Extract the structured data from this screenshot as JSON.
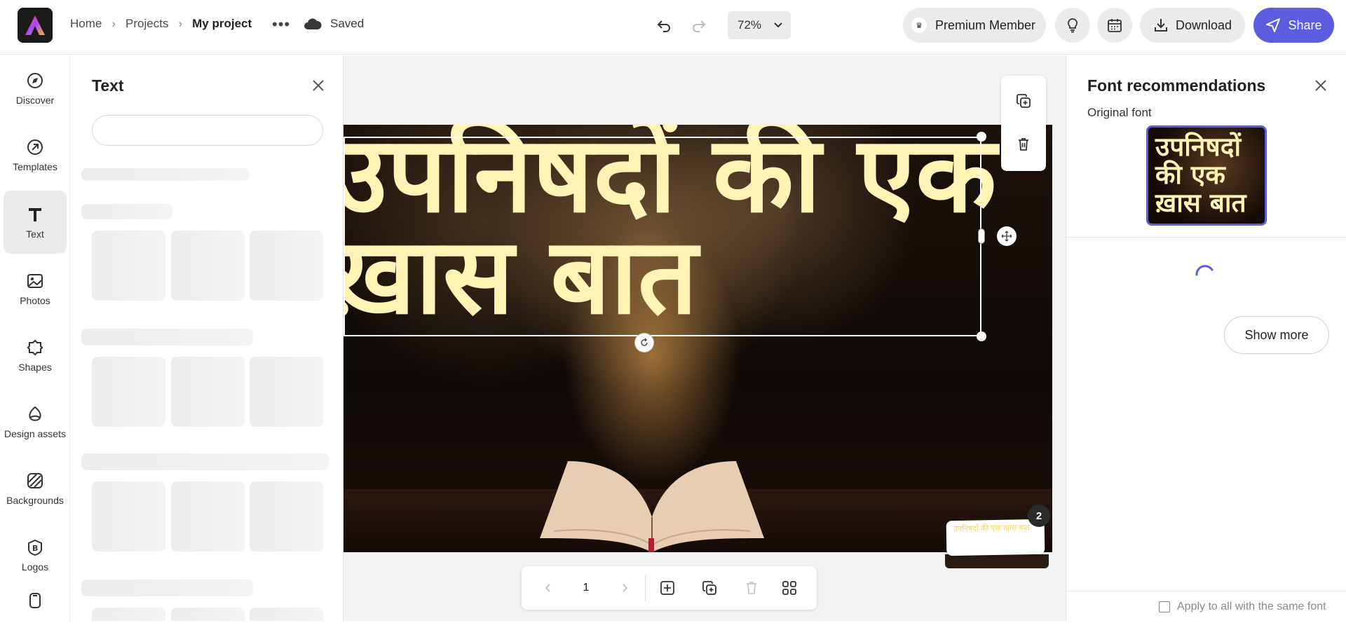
{
  "header": {
    "breadcrumb": [
      "Home",
      "Projects",
      "My project"
    ],
    "save_status": "Saved",
    "zoom": "72%",
    "premium_label": "Premium Member",
    "download_label": "Download",
    "share_label": "Share"
  },
  "rail": {
    "items": [
      {
        "label": "Discover"
      },
      {
        "label": "Templates"
      },
      {
        "label": "Text"
      },
      {
        "label": "Photos"
      },
      {
        "label": "Shapes"
      },
      {
        "label": "Design assets"
      },
      {
        "label": "Backgrounds"
      },
      {
        "label": "Logos"
      }
    ]
  },
  "text_panel": {
    "title": "Text",
    "search_placeholder": ""
  },
  "canvas": {
    "headline": "उपनिषदों की एक ख़ास बात",
    "headline_line1": "उपनिषदों की एक",
    "headline_line2": "ख़ास बात",
    "page_number": "1",
    "page_count_badge": "2",
    "thumb_text": "उपनिषदों की एक ख़ास बात"
  },
  "font_panel": {
    "title": "Font recommendations",
    "subtitle": "Original font",
    "preview_text": "उपनिषदों की एक ख़ास बात",
    "show_more": "Show more",
    "apply_all": "Apply to all with the same font"
  },
  "colors": {
    "accent": "#5c5ce0",
    "headline": "#fff3b5"
  }
}
